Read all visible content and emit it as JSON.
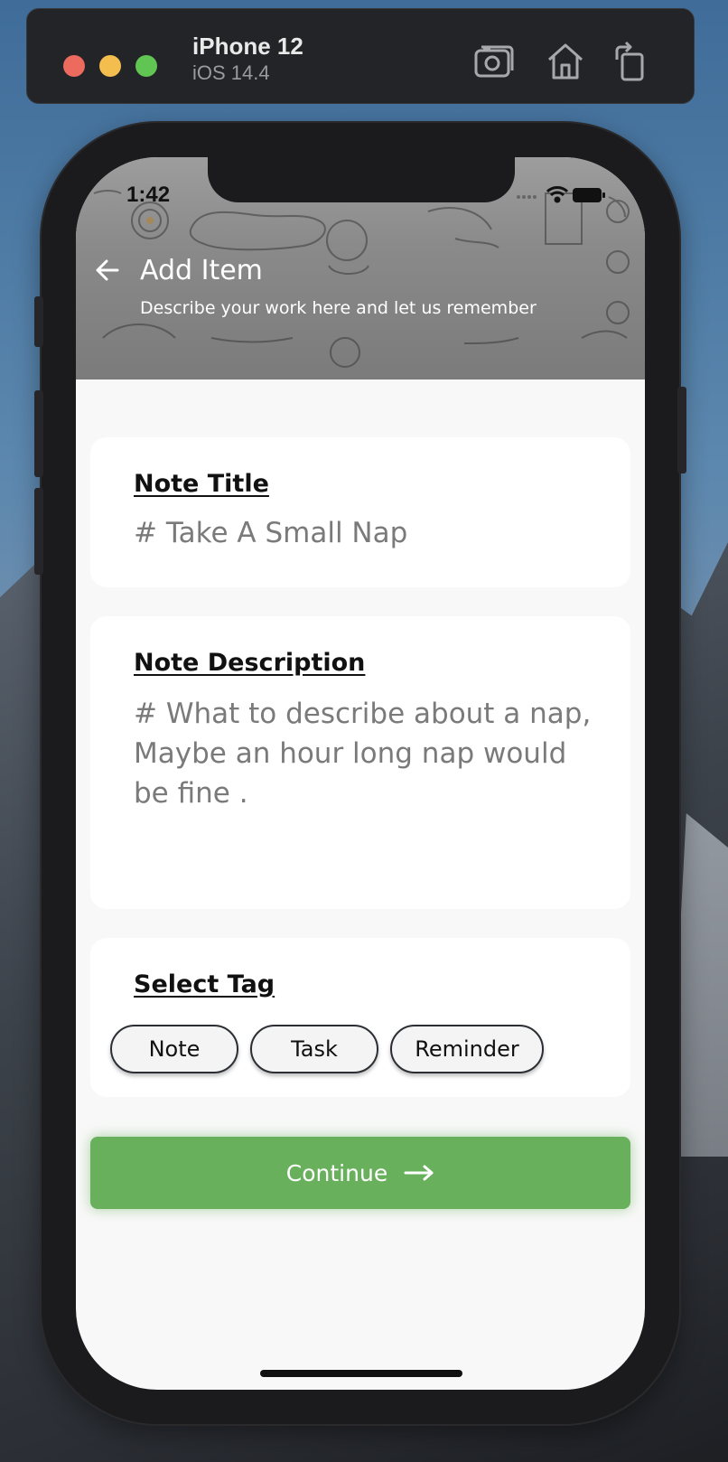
{
  "simulator": {
    "device_name": "iPhone 12",
    "os_version": "iOS 14.4",
    "buttons": [
      "screenshot-icon",
      "home-icon",
      "rotate-icon"
    ]
  },
  "status_bar": {
    "time": "1:42"
  },
  "header": {
    "title": "Add Item",
    "subtitle": "Describe your work here and let us remember"
  },
  "form": {
    "note_title": {
      "label": "Note Title",
      "placeholder": "# Take A Small Nap"
    },
    "note_description": {
      "label": "Note Description",
      "placeholder": "# What to describe about a nap, Maybe an hour long nap would be fine ."
    },
    "tags": {
      "label": "Select Tag",
      "options": [
        "Note",
        "Task",
        "Reminder"
      ]
    }
  },
  "continue_button": {
    "label": "Continue"
  },
  "colors": {
    "accent_green": "#69b05c",
    "header_gray": "#8a8a8a",
    "label_text": "#111111",
    "placeholder_text": "#7a7a7a"
  }
}
